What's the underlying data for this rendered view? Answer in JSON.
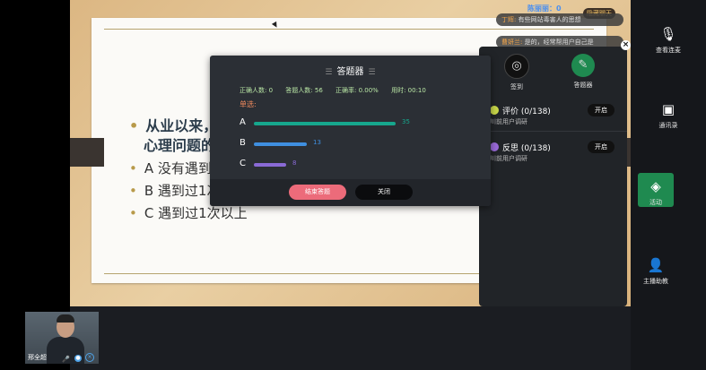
{
  "slide": {
    "question_line1": "从业以来，",
    "question_line2": "心理问题的",
    "option_a": "A 没有遇到",
    "option_b": "B 遇到过1次",
    "option_c": "C 遇到过1次以上"
  },
  "chat": {
    "top_user": "陈丽丽：0",
    "msg1_name": "丁辉:",
    "msg1_text": "有些网站毒害人的思想",
    "msg2_name": "曹妍兰:",
    "msg2_text": "是的，经常帮用户自己是",
    "hide_label": "隐藏聊天"
  },
  "dialog": {
    "title": "答题器",
    "stats": {
      "correct": "正确人数: 0",
      "answered": "答题人数: 56",
      "accuracy": "正确率: 0.00%",
      "time": "用时: 00:10"
    },
    "type_label": "单选:",
    "options": [
      {
        "label": "A",
        "count": "35",
        "value": 35,
        "color": "#16a78d"
      },
      {
        "label": "B",
        "count": "13",
        "value": 13,
        "color": "#3f8fe0"
      },
      {
        "label": "C",
        "count": "8",
        "value": 8,
        "color": "#8a6ad6"
      }
    ],
    "end_button": "结束答题",
    "close_button": "关闭"
  },
  "activity": {
    "checkin_label": "签到",
    "answer_label": "答题器",
    "rows": [
      {
        "title": "评价 (0/138)",
        "sub": "川前用户调研",
        "action": "开启"
      },
      {
        "title": "反思 (0/138)",
        "sub": "川前用户调研",
        "action": "开启"
      }
    ]
  },
  "sidebar": {
    "mic": "查看连麦",
    "contacts": "通讯录",
    "activity": "活动",
    "assistant": "主播助教"
  },
  "video": {
    "name": "邢全超"
  }
}
